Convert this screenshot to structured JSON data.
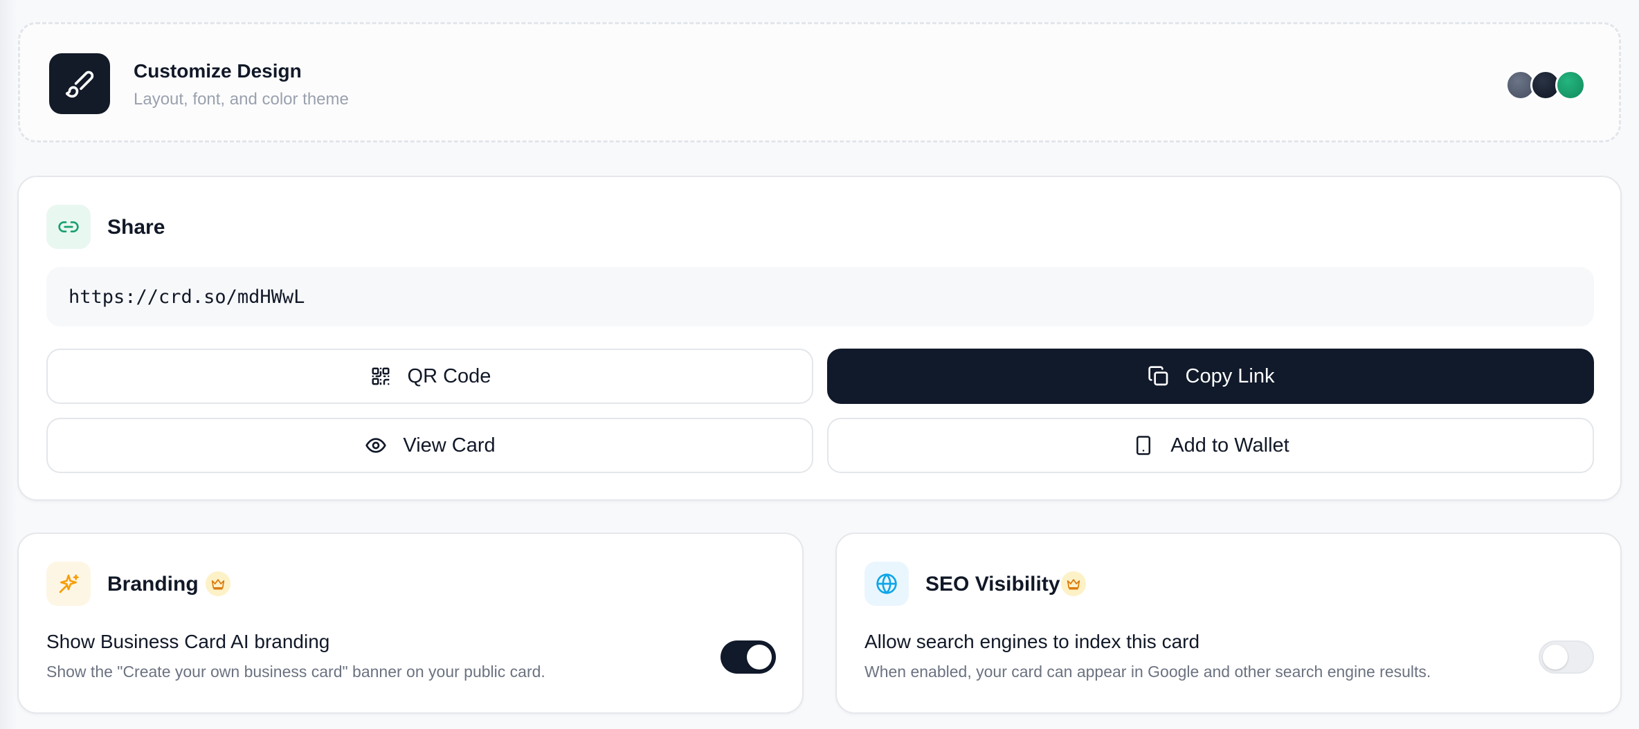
{
  "design": {
    "title": "Customize Design",
    "subtitle": "Layout, font, and color theme",
    "icon": "paintbrush-icon",
    "swatches": [
      "#566072",
      "#111a2b",
      "#16a06d"
    ]
  },
  "share": {
    "title": "Share",
    "icon": "link-icon",
    "url": "https://crd.so/mdHWwL",
    "buttons": {
      "qr_code": "QR Code",
      "copy_link": "Copy Link",
      "view_card": "View Card",
      "add_to_wallet": "Add to Wallet"
    }
  },
  "branding": {
    "title": "Branding",
    "icon": "sparkles-icon",
    "premium": true,
    "option_title": "Show Business Card AI branding",
    "option_desc": "Show the \"Create your own business card\" banner on your public card.",
    "enabled": true
  },
  "seo": {
    "title": "SEO Visibility",
    "icon": "globe-icon",
    "premium": true,
    "option_title": "Allow search engines to index this card",
    "option_desc": "When enabled, your card can appear in Google and other search engine results.",
    "enabled": false
  },
  "colors": {
    "dark": "#111a2b",
    "accent_green": "#16a06d",
    "amber": "#f59e0b",
    "sky": "#0ea5e9"
  }
}
